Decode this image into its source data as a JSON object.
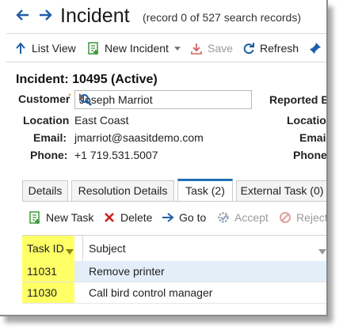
{
  "window": {
    "title": "Incident",
    "subtitle": "(record 0 of 527 search records)"
  },
  "toolbar": {
    "list_view": "List View",
    "new_incident": "New Incident",
    "save": "Save",
    "refresh": "Refresh"
  },
  "record": {
    "heading": "Incident: 10495 (Active)",
    "customer_label": "Customer",
    "customer_value": "Joseph Marriot",
    "reported_by_label": "Reported B",
    "location_label": "Location",
    "location_value": "East Coast",
    "location_label_right": "Location",
    "email_label": "Email:",
    "email_value": "jmarriot@saasitdemo.com",
    "email_label_right": "Emai",
    "phone_label": "Phone:",
    "phone_value": "+1 719.531.5007",
    "phone_label_right": "Phone"
  },
  "tabs": [
    {
      "label": "Details"
    },
    {
      "label": "Resolution Details"
    },
    {
      "label": "Task (2)"
    },
    {
      "label": "External Task (0)"
    }
  ],
  "grid_toolbar": {
    "new_task": "New Task",
    "delete": "Delete",
    "go_to": "Go to",
    "accept": "Accept",
    "reject": "Reject"
  },
  "grid": {
    "columns": [
      "Task ID",
      "Subject"
    ],
    "rows": [
      {
        "task_id": "11031",
        "subject": "Remove printer"
      },
      {
        "task_id": "11030",
        "subject": "Call bird control manager"
      }
    ]
  },
  "colors": {
    "accent": "#1f5fa8",
    "highlight": "#ffff66",
    "selected_row": "#e3eef9",
    "delete_red": "#d02020",
    "new_green": "#3a9a3a"
  }
}
